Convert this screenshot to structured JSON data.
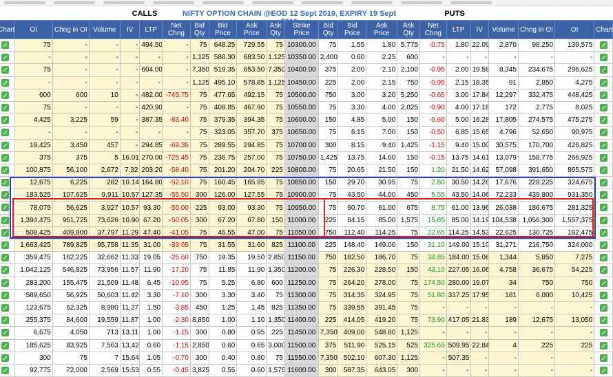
{
  "header": {
    "calls_label": "CALLS",
    "puts_label": "PUTS",
    "title": "NIFTY OPTION CHAIN @EOD 12 Sept 2019, EXPIRY 19 Sept 2019"
  },
  "columns": [
    "Chart",
    "OI",
    "Chng in OI",
    "Volume",
    "IV",
    "LTP",
    "Net Chng",
    "Bid Qty",
    "Bid Price",
    "Ask Price",
    "Ask Qty",
    "Strike Price",
    "Bid Qty",
    "Bid Price",
    "Ask Price",
    "Ask Qty",
    "Net Chng",
    "LTP",
    "IV",
    "Volume",
    "Chng in OI",
    "OI",
    "Chart"
  ],
  "colors": {
    "header_bg": "#3c62a8",
    "itm_bg": "#fdf6d3",
    "negative": "#e00000",
    "positive": "#159b15",
    "red_box": "#e02020",
    "blue_box": "#2a3fb0"
  },
  "rows": [
    [
      "75",
      "-",
      "-",
      "-",
      "494.50",
      "-",
      "75",
      "648.25",
      "729.55",
      "75",
      "10300.00",
      "75",
      "1.55",
      "1.80",
      "5,775",
      "-0.75",
      "1.80",
      "22.09",
      "2,870",
      "98,250",
      "139,575"
    ],
    [
      "-",
      "-",
      "-",
      "-",
      "-",
      "-",
      "1,125",
      "580.30",
      "683.50",
      "1,125",
      "10350.00",
      "2,400",
      "0.60",
      "2.25",
      "600",
      "-",
      "-",
      "-",
      "-",
      "-",
      "-"
    ],
    [
      "75",
      "-",
      "-",
      "-",
      "604.00",
      "-",
      "7,350",
      "519.35",
      "653.50",
      "7,350",
      "10400.00",
      "375",
      "2.00",
      "2.10",
      "2,100",
      "-0.95",
      "2.00",
      "19.58",
      "8,345",
      "234,675",
      "296,625"
    ],
    [
      "-",
      "-",
      "-",
      "-",
      "-",
      "-",
      "1,125",
      "495.10",
      "578.85",
      "1,125",
      "10450.00",
      "225",
      "2.00",
      "2.15",
      "750",
      "-0.95",
      "2.15",
      "18.35",
      "91",
      "2,850",
      "4,275"
    ],
    [
      "600",
      "600",
      "10",
      "-",
      "482.00",
      "-745.75",
      "75",
      "477.65",
      "492.15",
      "75",
      "10500.00",
      "750",
      "3.00",
      "3.20",
      "5,250",
      "-0.65",
      "3.00",
      "17.84",
      "12,297",
      "332,475",
      "448,425"
    ],
    [
      "75",
      "-",
      "-",
      "-",
      "420.90",
      "-",
      "75",
      "408.85",
      "467.90",
      "75",
      "10550.00",
      "75",
      "3.30",
      "4.00",
      "2,025",
      "-0.90",
      "4.00",
      "17.18",
      "172",
      "2,775",
      "8,025"
    ],
    [
      "4,425",
      "3,225",
      "59",
      "-",
      "387.35",
      "-83.40",
      "75",
      "379.35",
      "394.35",
      "75",
      "10600.00",
      "150",
      "4.85",
      "5.00",
      "150",
      "-0.60",
      "5.00",
      "16.28",
      "17,805",
      "274,575",
      "475,275"
    ],
    [
      "-",
      "-",
      "-",
      "-",
      "-",
      "-",
      "75",
      "323.05",
      "357.70",
      "375",
      "10650.00",
      "75",
      "6.15",
      "7.00",
      "150",
      "-0.50",
      "6.85",
      "15.65",
      "4,796",
      "52,650",
      "90,975"
    ],
    [
      "19,425",
      "3,450",
      "457",
      "-",
      "294.85",
      "-69.35",
      "75",
      "289.55",
      "294.85",
      "75",
      "10700.00",
      "300",
      "8.15",
      "9.40",
      "1,425",
      "-1.15",
      "9.40",
      "15.00",
      "30,575",
      "170,700",
      "426,825"
    ],
    [
      "375",
      "375",
      "5",
      "16.01",
      "270.00",
      "-725.45",
      "75",
      "236.75",
      "257.00",
      "75",
      "10750.00",
      "1,425",
      "13.75",
      "14.60",
      "150",
      "-0.15",
      "13.75",
      "14.61",
      "13,079",
      "158,775",
      "266,925"
    ],
    [
      "100,875",
      "56,100",
      "2,672",
      "7.32",
      "203.20",
      "-58.40",
      "75",
      "201.20",
      "204.70",
      "225",
      "10800.00",
      "75",
      "20.65",
      "21.50",
      "150",
      "1.20",
      "21.50",
      "14.62",
      "57,098",
      "391,650",
      "865,575"
    ],
    [
      "12,675",
      "6,225",
      "282",
      "10.14",
      "164.80",
      "-52.10",
      "75",
      "160.45",
      "165.85",
      "75",
      "10850.00",
      "150",
      "29.70",
      "30.95",
      "75",
      "2.80",
      "30.50",
      "14.26",
      "17,676",
      "228,225",
      "324,675"
    ],
    [
      "183,525",
      "107,625",
      "9,911",
      "10.57",
      "127.35",
      "-55.50",
      "300",
      "126.00",
      "127.55",
      "75",
      "10900.00",
      "75",
      "43.50",
      "44.00",
      "450",
      "5.55",
      "43.50",
      "14.06",
      "72,233",
      "439,800",
      "931,350"
    ],
    [
      "78,075",
      "56,625",
      "3,927",
      "10.57",
      "93.30",
      "-55.00",
      "225",
      "93.00",
      "93.30",
      "75",
      "10950.00",
      "75",
      "60.70",
      "61.00",
      "675",
      "8.75",
      "61.00",
      "13.96",
      "26,038",
      "186,675",
      "281,325"
    ],
    [
      "1,394,475",
      "961,725",
      "73,626",
      "10.90",
      "67.20",
      "-50.05",
      "300",
      "67.20",
      "67.80",
      "150",
      "11000.00",
      "225",
      "84.15",
      "85.00",
      "1,575",
      "15.85",
      "85.00",
      "14.19",
      "104,538",
      "1,056,300",
      "1,557,375"
    ],
    [
      "508,425",
      "409,800",
      "37,797",
      "11.29",
      "47.40",
      "-41.05",
      "75",
      "46.55",
      "47.00",
      "75",
      "11050.00",
      "750",
      "112.40",
      "114.25",
      "75",
      "22.65",
      "114.25",
      "14.53",
      "22,625",
      "130,725",
      "182,475"
    ],
    [
      "1,663,425",
      "789,825",
      "95,758",
      "11.35",
      "31.00",
      "-33.65",
      "75",
      "31.55",
      "31.60",
      "825",
      "11100.00",
      "225",
      "148.40",
      "149.00",
      "150",
      "31.10",
      "149.00",
      "15.10",
      "31,271",
      "216,750",
      "324,000"
    ],
    [
      "359,475",
      "162,225",
      "32,662",
      "11.33",
      "19.05",
      "-25.60",
      "750",
      "19.35",
      "19.50",
      "2,850",
      "11150.00",
      "750",
      "182.50",
      "186.70",
      "75",
      "34.85",
      "184.00",
      "15.06",
      "1,344",
      "5,850",
      "7,275"
    ],
    [
      "1,042,125",
      "546,825",
      "73,956",
      "11.57",
      "11.90",
      "-17.20",
      "75",
      "11.85",
      "11.90",
      "1,350",
      "11200.00",
      "75",
      "226.30",
      "228.50",
      "150",
      "43.10",
      "227.05",
      "16.06",
      "4,758",
      "36,675",
      "54,225"
    ],
    [
      "283,200",
      "155,475",
      "21,509",
      "11.48",
      "6.45",
      "-10.95",
      "75",
      "5.25",
      "6.80",
      "600",
      "11250.00",
      "75",
      "264.20",
      "278.00",
      "75",
      "174.50",
      "280.00",
      "19.07",
      "34",
      "750",
      "750"
    ],
    [
      "589,650",
      "56,925",
      "50,603",
      "11.42",
      "3.30",
      "-7.10",
      "300",
      "3.30",
      "3.40",
      "75",
      "11300.00",
      "75",
      "314.35",
      "324.95",
      "75",
      "51.80",
      "317.25",
      "17.95",
      "181",
      "6,000",
      "10,425"
    ],
    [
      "123,675",
      "62,325",
      "8,980",
      "11.27",
      "1.50",
      "-3.85",
      "450",
      "1.25",
      "1.45",
      "825",
      "11350.00",
      "75",
      "339.55",
      "391.45",
      "75",
      "-",
      "-",
      "-",
      "-",
      "-",
      "-"
    ],
    [
      "255,375",
      "84,600",
      "19,559",
      "11.87",
      "1.00",
      "-2.30",
      "8,850",
      "1.00",
      "1.10",
      "1,350",
      "11400.00",
      "225",
      "414.05",
      "419.20",
      "75",
      "73.90",
      "417.05",
      "21.83",
      "189",
      "12,675",
      "13,050"
    ],
    [
      "6,675",
      "4,050",
      "713",
      "13.11",
      "1.00",
      "-1.15",
      "300",
      "0.80",
      "0.95",
      "225",
      "11450.00",
      "7,350",
      "409.00",
      "548.80",
      "1,125",
      "-",
      "-",
      "-",
      "-",
      "-",
      "-"
    ],
    [
      "185,625",
      "83,925",
      "7,563",
      "13.42",
      "0.60",
      "-1.15",
      "2,850",
      "0.60",
      "0.65",
      "3,000",
      "11500.00",
      "375",
      "511.90",
      "525.15",
      "525",
      "325.65",
      "509.95",
      "22.84",
      "4",
      "225",
      "225"
    ],
    [
      "300",
      "75",
      "7",
      "15.64",
      "1.05",
      "-0.70",
      "300",
      "0.40",
      "0.80",
      "75",
      "11550.00",
      "7,350",
      "502.10",
      "607.30",
      "1,125",
      "-",
      "507.35",
      "-",
      "-",
      "-",
      "-"
    ],
    [
      "92,775",
      "72,000",
      "2,569",
      "15.53",
      "0.55",
      "-0.45",
      "3,825",
      "0.55",
      "0.60",
      "1,575",
      "11600.00",
      "300",
      "587.35",
      "643.05",
      "300",
      "-",
      "-",
      "-",
      "-",
      "-",
      "-"
    ]
  ]
}
